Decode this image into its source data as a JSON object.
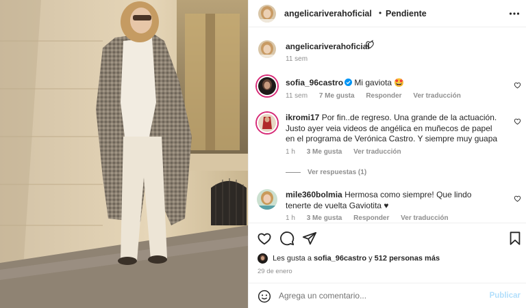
{
  "post": {
    "username": "angelicariverahoficial",
    "separator": "•",
    "follow_status": "Pendiente",
    "more_icon": "more-horizontal-icon"
  },
  "caption": {
    "username": "angelicariverahoficial",
    "emoji": "heart-with-ribbon-emoji",
    "time": "11 sem"
  },
  "comments": [
    {
      "username": "sofia_96castro",
      "verified": true,
      "text": "Mi gaviota 🤩",
      "time": "11 sem",
      "likes": "7 Me gusta",
      "reply": "Responder",
      "translate": "Ver traducción"
    },
    {
      "username": "ikromi17",
      "verified": false,
      "text": "Por fin..de regreso. Una grande de la actuación. Justo ayer veia videos de angélica en muñecos de papel en el programa de Verónica Castro. Y siempre muy guapa",
      "time": "1 h",
      "likes": "3 Me gusta",
      "translate": "Ver traducción",
      "view_replies": "Ver respuestas (1)"
    },
    {
      "username": "mile360bolmia",
      "verified": false,
      "text": "Hermosa como siempre! Que lindo tenerte de vuelta Gaviotita ♥",
      "time": "1 h",
      "likes": "3 Me gusta",
      "reply": "Responder",
      "translate": "Ver traducción"
    }
  ],
  "actions": {
    "icons": [
      "heart-icon",
      "comment-icon",
      "share-icon",
      "bookmark-icon"
    ]
  },
  "likes": {
    "prefix": "Les gusta a",
    "user": "sofia_96castro",
    "middle": "y",
    "others": "512 personas más"
  },
  "date": "29 de enero",
  "add_comment": {
    "placeholder": "Agrega un comentario...",
    "publish": "Publicar"
  },
  "colors": {
    "accent_link": "#b2dffc",
    "secondary_text": "#8e8e8e",
    "verified": "#0095f6",
    "story_ring": "#d62976"
  }
}
